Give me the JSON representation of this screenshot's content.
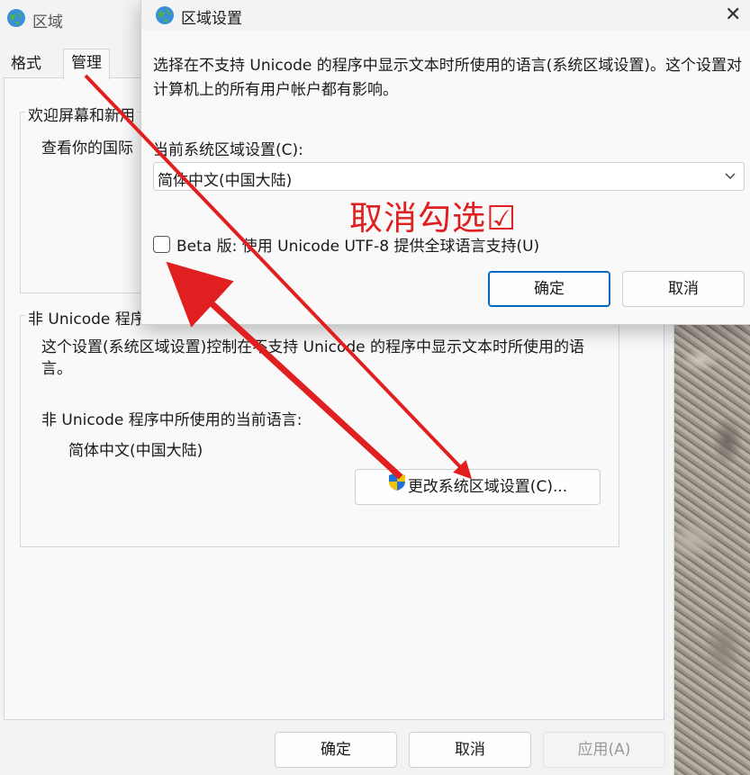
{
  "main_window": {
    "title": "区域",
    "tabs": [
      {
        "label": "格式"
      },
      {
        "label": "管理"
      }
    ],
    "welcome_group": {
      "title": "欢迎屏幕和新用",
      "text": "查看你的国际"
    },
    "nonunicode_group": {
      "title": "非 Unicode 程序",
      "description": "这个设置(系统区域设置)控制在不支持 Unicode 的程序中显示文本时所使用的语言。",
      "current_label": "非 Unicode 程序中所使用的当前语言:",
      "current_value": "简体中文(中国大陆)",
      "change_button": "更改系统区域设置(C)..."
    },
    "buttons": {
      "ok": "确定",
      "cancel": "取消",
      "apply": "应用(A)"
    }
  },
  "locale_dialog": {
    "title": "区域设置",
    "close_glyph": "✕",
    "description": "选择在不支持 Unicode 的程序中显示文本时所使用的语言(系统区域设置)。这个设置对计算机上的所有用户帐户都有影响。",
    "current_label": "当前系统区域设置(C):",
    "selected_locale": "简体中文(中国大陆)",
    "utf8_checkbox": {
      "label": "Beta 版: 使用 Unicode UTF-8 提供全球语言支持(U)",
      "checked": false
    },
    "buttons": {
      "ok": "确定",
      "cancel": "取消"
    }
  },
  "annotation": {
    "text": "取消勾选☑",
    "color": "#e02020"
  },
  "colors": {
    "accent": "#0067c0",
    "annotation_red": "#e02020"
  },
  "icons": {
    "window": "globe-icon",
    "uac": "uac-shield-icon",
    "dropdown": "chevron-down-icon",
    "close": "close-icon"
  }
}
